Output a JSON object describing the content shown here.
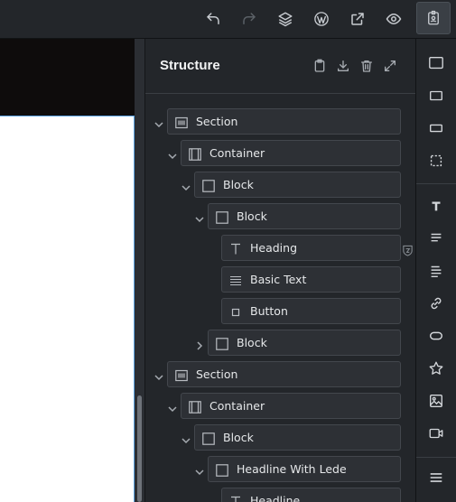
{
  "toolbar": {
    "buttons": [
      {
        "name": "undo-icon"
      },
      {
        "name": "redo-icon"
      },
      {
        "name": "layers-icon"
      },
      {
        "name": "wordpress-icon"
      },
      {
        "name": "external-link-icon"
      },
      {
        "name": "preview-eye-icon"
      },
      {
        "name": "badge-user-icon"
      }
    ]
  },
  "structure": {
    "title": "Structure",
    "tree": [
      {
        "label": "Section",
        "icon": "section-icon",
        "level": 0,
        "expanded": true
      },
      {
        "label": "Container",
        "icon": "container-icon",
        "level": 1,
        "expanded": true
      },
      {
        "label": "Block",
        "icon": "block-icon",
        "level": 2,
        "expanded": true
      },
      {
        "label": "Block",
        "icon": "block-icon",
        "level": 3,
        "expanded": true
      },
      {
        "label": "Heading",
        "icon": "heading-icon",
        "level": 4
      },
      {
        "label": "Basic Text",
        "icon": "text-icon",
        "level": 4
      },
      {
        "label": "Button",
        "icon": "button-icon",
        "level": 4
      },
      {
        "label": "Block",
        "icon": "block-icon",
        "level": 3,
        "expanded": false
      },
      {
        "label": "Section",
        "icon": "section-icon",
        "level": 0,
        "expanded": true
      },
      {
        "label": "Container",
        "icon": "container-icon",
        "level": 1,
        "expanded": true
      },
      {
        "label": "Block",
        "icon": "block-icon",
        "level": 2,
        "expanded": true
      },
      {
        "label": "Headline With Lede",
        "icon": "block-icon",
        "level": 3,
        "expanded": true
      },
      {
        "label": "Headline",
        "icon": "heading-icon",
        "level": 4
      }
    ]
  },
  "colors": {
    "panel_bg": "#23262a",
    "row_bg": "#2d3035",
    "selection": "#5da5e6"
  }
}
